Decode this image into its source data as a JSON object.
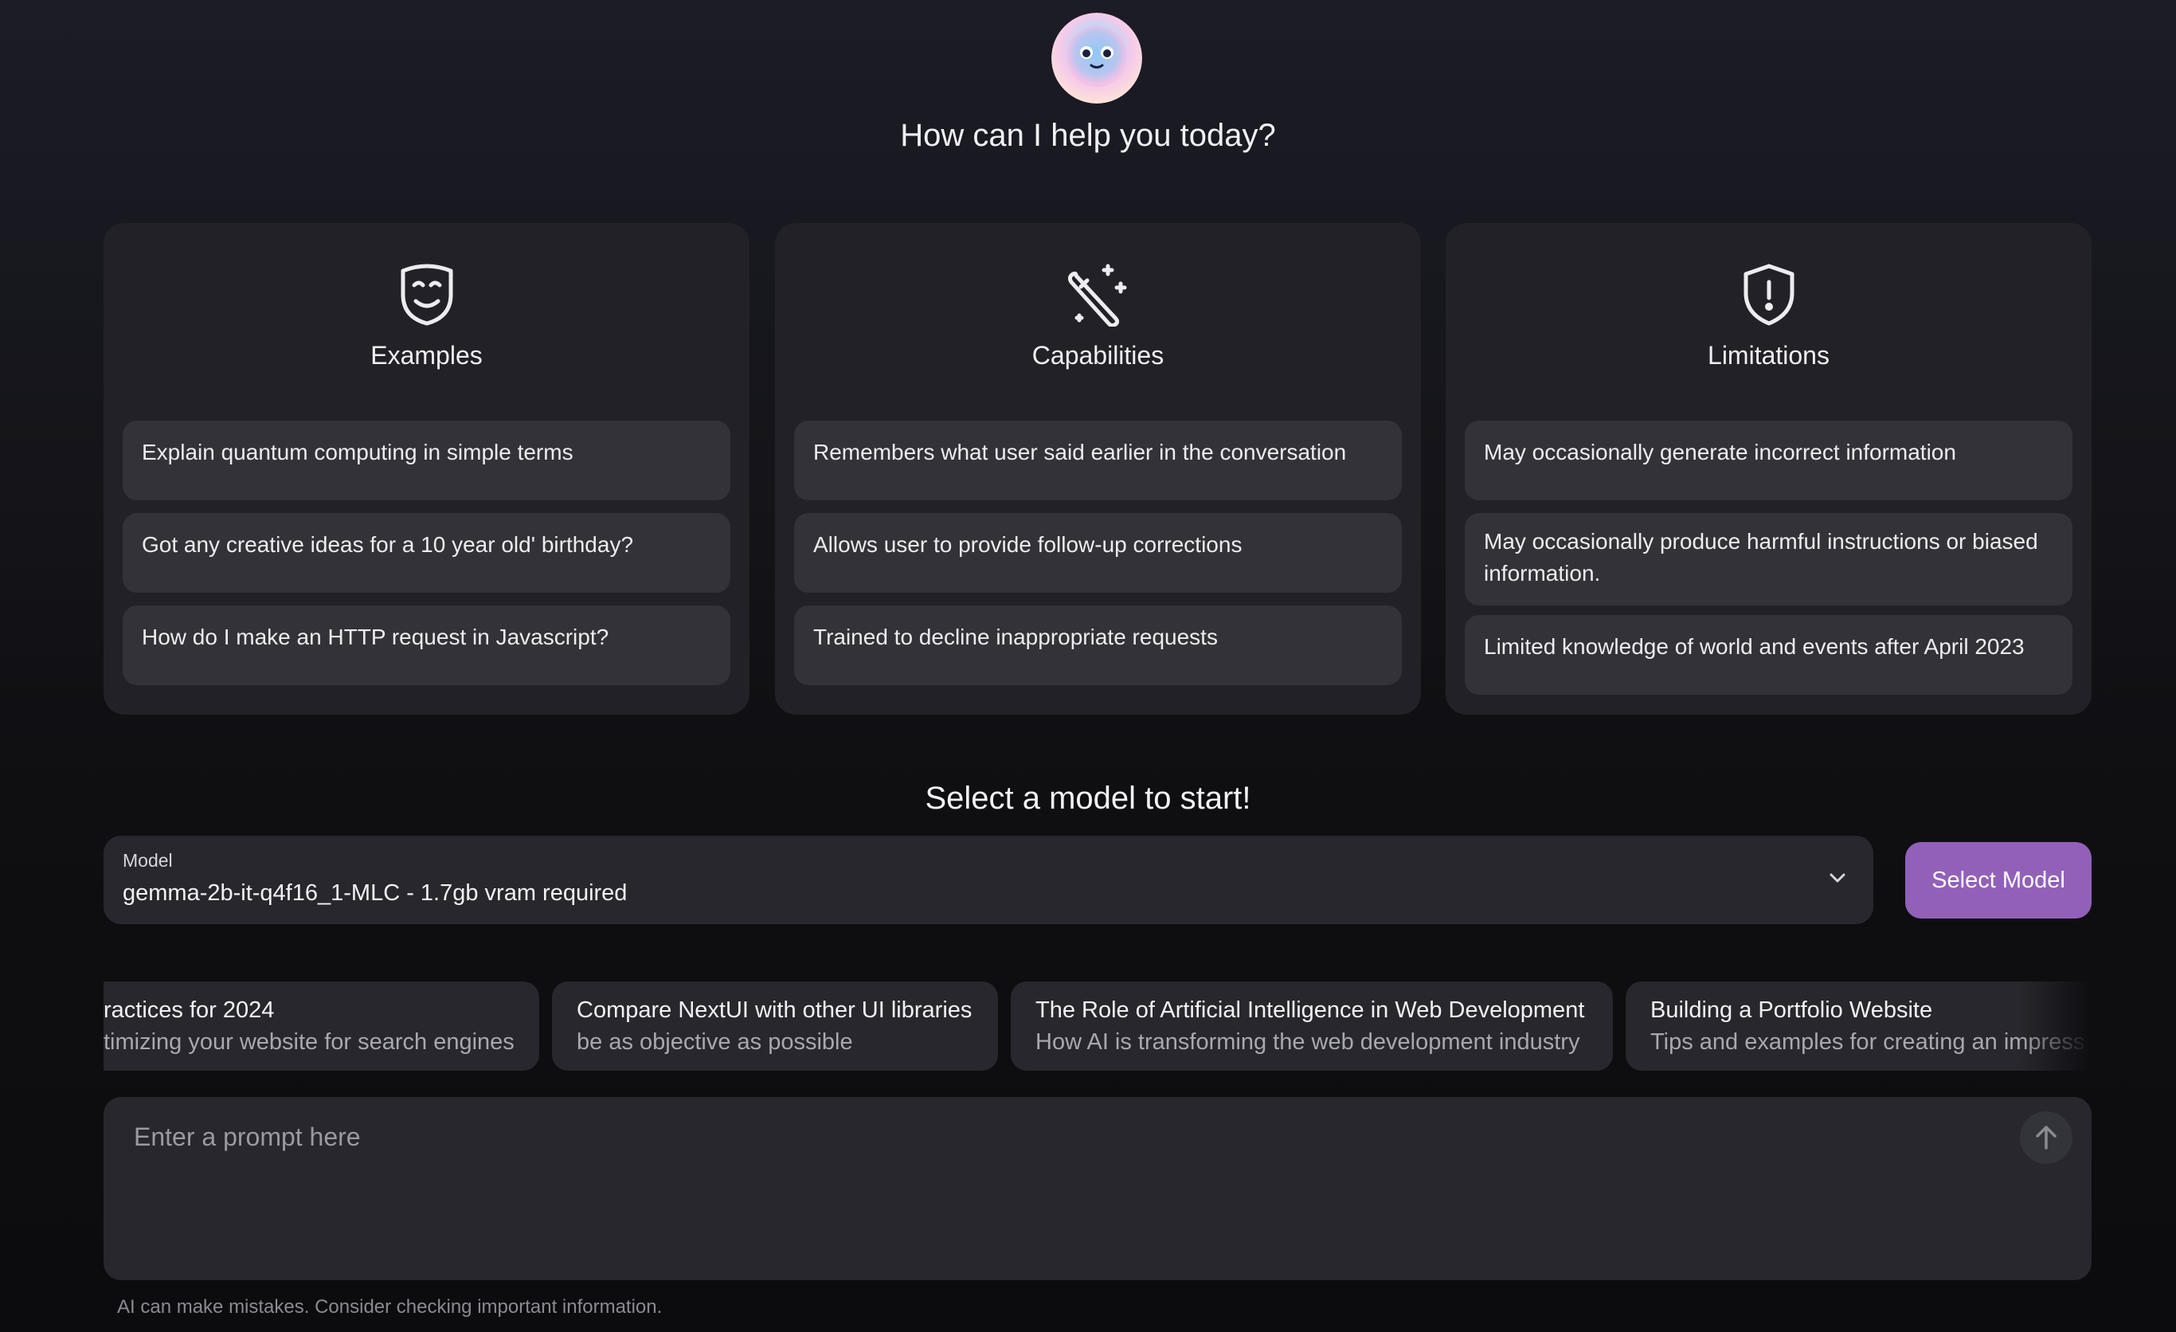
{
  "header": {
    "greeting": "How can I help you today?",
    "avatar_icon": "smiling-face-avatar"
  },
  "cards": [
    {
      "title": "Examples",
      "icon": "theater-mask-icon",
      "items": [
        "Explain quantum computing in simple terms",
        "Got any creative ideas for a 10 year old' birthday?",
        "How do I make an HTTP request in Javascript?"
      ]
    },
    {
      "title": "Capabilities",
      "icon": "magic-wand-icon",
      "items": [
        "Remembers what user said earlier in the conversation",
        "Allows user to provide follow-up corrections",
        "Trained to decline inappropriate requests"
      ]
    },
    {
      "title": "Limitations",
      "icon": "shield-alert-icon",
      "items": [
        "May occasionally generate incorrect information",
        "May occasionally produce harmful instructions or biased information.",
        "Limited knowledge of world and events after April 2023"
      ]
    }
  ],
  "model_section": {
    "title": "Select a model to start!",
    "label": "Model",
    "selected_value": "gemma-2b-it-q4f16_1-MLC - 1.7gb vram required",
    "button_label": "Select Model"
  },
  "suggestions": [
    {
      "title": "ractices for 2024",
      "subtitle": "timizing your website for search engines"
    },
    {
      "title": "Compare NextUI with other UI libraries",
      "subtitle": "be as objective as possible"
    },
    {
      "title": "The Role of Artificial Intelligence in Web Development",
      "subtitle": "How AI is transforming the web development industry"
    },
    {
      "title": "Building a Portfolio Website",
      "subtitle": "Tips and examples for creating an impress"
    }
  ],
  "prompt": {
    "placeholder": "Enter a prompt here"
  },
  "footer": {
    "disclaimer": "AI can make mistakes. Consider checking important information."
  },
  "colors": {
    "accent": "#9260b9",
    "card_bg": "#212127",
    "item_bg": "#323238",
    "input_bg": "#27272d"
  }
}
